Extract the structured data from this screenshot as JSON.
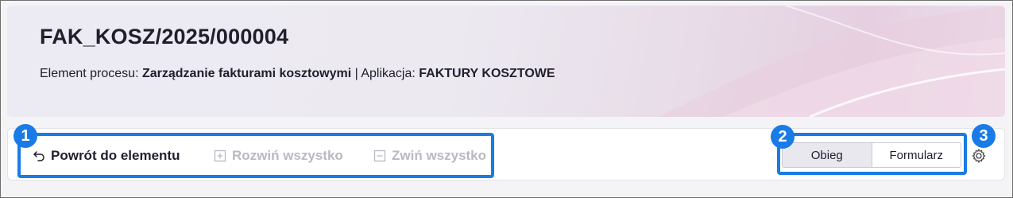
{
  "header": {
    "title": "FAK_KOSZ/2025/000004",
    "process_label": "Element procesu:",
    "process_value": "Zarządzanie fakturami kosztowymi",
    "separator": "|",
    "app_label": "Aplikacja:",
    "app_value": "FAKTURY KOSZTOWE"
  },
  "toolbar": {
    "back_label": "Powrót do elementu",
    "expand_label": "Rozwiń wszystko",
    "collapse_label": "Zwiń wszystko",
    "segments": [
      "Obieg",
      "Formularz"
    ],
    "active_segment": "Obieg"
  },
  "callouts": [
    "1",
    "2",
    "3"
  ],
  "colors": {
    "accent": "#1a7be6",
    "text": "#1f1f2e",
    "disabled": "#b9b9c2"
  },
  "icons": {
    "back": "undo-arrow-icon",
    "expand": "plus-square-icon",
    "collapse": "minus-square-icon",
    "settings": "gear-icon"
  }
}
